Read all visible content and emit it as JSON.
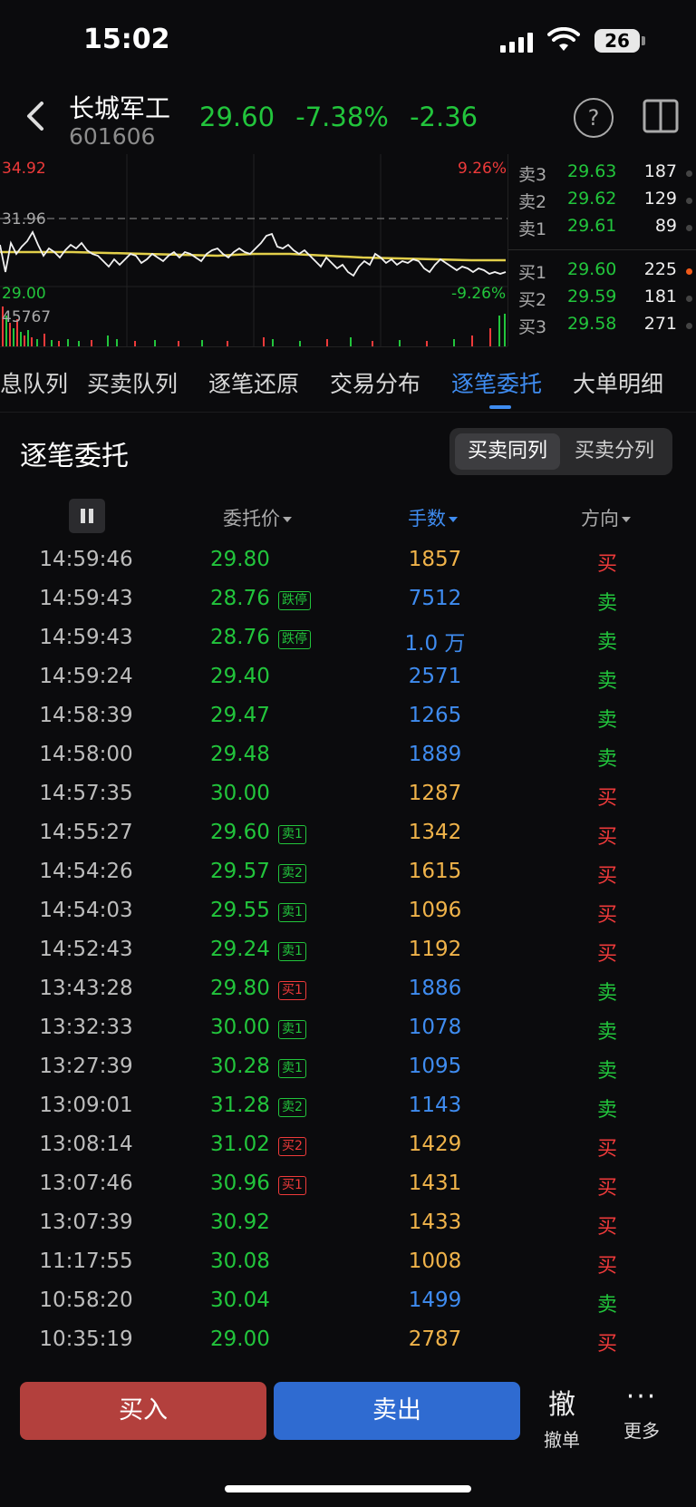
{
  "status": {
    "time": "15:02",
    "battery": "26"
  },
  "header": {
    "name": "长城军工",
    "code": "601606",
    "price": "29.60",
    "change_pct": "-7.38%",
    "change_abs": "-2.36",
    "help_label": "?"
  },
  "chart": {
    "high": "34.92",
    "prev_close": "31.96",
    "low": "29.00",
    "high_pct": "9.26%",
    "low_pct": "-9.26%",
    "volume": "45767"
  },
  "order_book": {
    "asks": [
      {
        "label": "卖3",
        "price": "29.63",
        "vol": "187"
      },
      {
        "label": "卖2",
        "price": "29.62",
        "vol": "129"
      },
      {
        "label": "卖1",
        "price": "29.61",
        "vol": "89"
      }
    ],
    "bids": [
      {
        "label": "买1",
        "price": "29.60",
        "vol": "225"
      },
      {
        "label": "买2",
        "price": "29.59",
        "vol": "181"
      },
      {
        "label": "买3",
        "price": "29.58",
        "vol": "271"
      }
    ]
  },
  "tabs": [
    "息队列",
    "买卖队列",
    "逐笔还原",
    "交易分布",
    "逐笔委托",
    "大单明细"
  ],
  "section": {
    "title": "逐笔委托",
    "seg_left": "买卖同列",
    "seg_right": "买卖分列"
  },
  "columns": {
    "price": "委托价",
    "volume": "手数",
    "direction": "方向"
  },
  "trades": [
    {
      "time": "14:59:46",
      "price": "29.80",
      "tag": "",
      "tag_color": "",
      "vol": "1857",
      "vol_color": "orange",
      "dir": "买"
    },
    {
      "time": "14:59:43",
      "price": "28.76",
      "tag": "跌停",
      "tag_color": "green",
      "vol": "7512",
      "vol_color": "blue",
      "dir": "卖"
    },
    {
      "time": "14:59:43",
      "price": "28.76",
      "tag": "跌停",
      "tag_color": "green",
      "vol": "1.0 万",
      "vol_color": "blue",
      "dir": "卖"
    },
    {
      "time": "14:59:24",
      "price": "29.40",
      "tag": "",
      "tag_color": "",
      "vol": "2571",
      "vol_color": "blue",
      "dir": "卖"
    },
    {
      "time": "14:58:39",
      "price": "29.47",
      "tag": "",
      "tag_color": "",
      "vol": "1265",
      "vol_color": "blue",
      "dir": "卖"
    },
    {
      "time": "14:58:00",
      "price": "29.48",
      "tag": "",
      "tag_color": "",
      "vol": "1889",
      "vol_color": "blue",
      "dir": "卖"
    },
    {
      "time": "14:57:35",
      "price": "30.00",
      "tag": "",
      "tag_color": "",
      "vol": "1287",
      "vol_color": "orange",
      "dir": "买"
    },
    {
      "time": "14:55:27",
      "price": "29.60",
      "tag": "卖1",
      "tag_color": "green",
      "vol": "1342",
      "vol_color": "orange",
      "dir": "买"
    },
    {
      "time": "14:54:26",
      "price": "29.57",
      "tag": "卖2",
      "tag_color": "green",
      "vol": "1615",
      "vol_color": "orange",
      "dir": "买"
    },
    {
      "time": "14:54:03",
      "price": "29.55",
      "tag": "卖1",
      "tag_color": "green",
      "vol": "1096",
      "vol_color": "orange",
      "dir": "买"
    },
    {
      "time": "14:52:43",
      "price": "29.24",
      "tag": "卖1",
      "tag_color": "green",
      "vol": "1192",
      "vol_color": "orange",
      "dir": "买"
    },
    {
      "time": "13:43:28",
      "price": "29.80",
      "tag": "买1",
      "tag_color": "red",
      "vol": "1886",
      "vol_color": "blue",
      "dir": "卖"
    },
    {
      "time": "13:32:33",
      "price": "30.00",
      "tag": "卖1",
      "tag_color": "green",
      "vol": "1078",
      "vol_color": "blue",
      "dir": "卖"
    },
    {
      "time": "13:27:39",
      "price": "30.28",
      "tag": "卖1",
      "tag_color": "green",
      "vol": "1095",
      "vol_color": "blue",
      "dir": "卖"
    },
    {
      "time": "13:09:01",
      "price": "31.28",
      "tag": "卖2",
      "tag_color": "green",
      "vol": "1143",
      "vol_color": "blue",
      "dir": "卖"
    },
    {
      "time": "13:08:14",
      "price": "31.02",
      "tag": "买2",
      "tag_color": "red",
      "vol": "1429",
      "vol_color": "orange",
      "dir": "买"
    },
    {
      "time": "13:07:46",
      "price": "30.96",
      "tag": "买1",
      "tag_color": "red",
      "vol": "1431",
      "vol_color": "orange",
      "dir": "买"
    },
    {
      "time": "13:07:39",
      "price": "30.92",
      "tag": "",
      "tag_color": "",
      "vol": "1433",
      "vol_color": "orange",
      "dir": "买"
    },
    {
      "time": "11:17:55",
      "price": "30.08",
      "tag": "",
      "tag_color": "",
      "vol": "1008",
      "vol_color": "orange",
      "dir": "买"
    },
    {
      "time": "10:58:20",
      "price": "30.04",
      "tag": "",
      "tag_color": "",
      "vol": "1499",
      "vol_color": "blue",
      "dir": "卖"
    },
    {
      "time": "10:35:19",
      "price": "29.00",
      "tag": "",
      "tag_color": "",
      "vol": "2787",
      "vol_color": "orange",
      "dir": "买"
    }
  ],
  "bottom": {
    "buy": "买入",
    "sell": "卖出",
    "cancel_icon": "撤",
    "cancel": "撤单",
    "more_icon": "···",
    "more": "更多"
  },
  "colors": {
    "up": "#ee3a3a",
    "down": "#22c53c",
    "accent": "#3f8cf0",
    "orange": "#f0b34a"
  }
}
